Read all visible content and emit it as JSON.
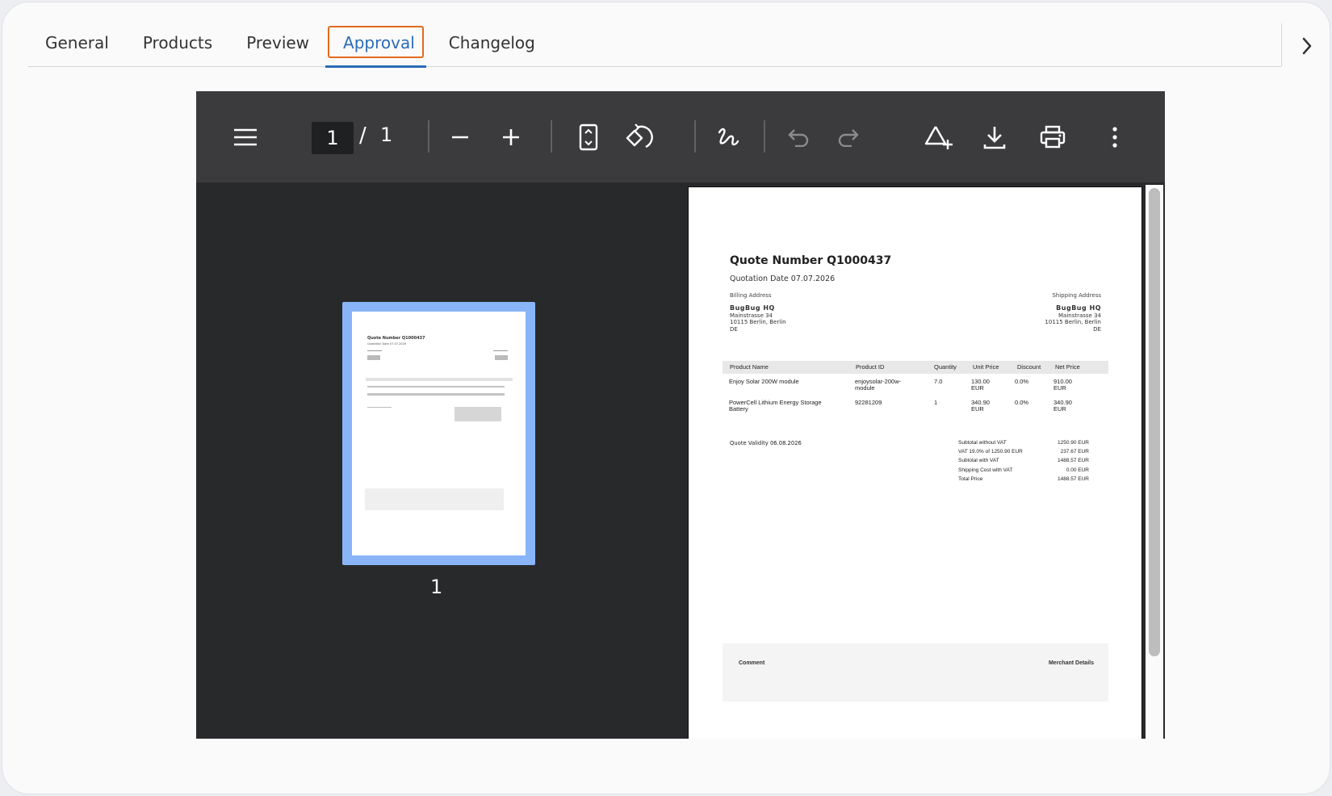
{
  "tabs": [
    {
      "label": "General",
      "active": false
    },
    {
      "label": "Products",
      "active": false
    },
    {
      "label": "Preview",
      "active": false
    },
    {
      "label": "Approval",
      "active": true
    },
    {
      "label": "Changelog",
      "active": false
    }
  ],
  "colors": {
    "accent": "#2b6cb8",
    "focus_outline": "#e26b1d",
    "thumb_highlight": "#8ab4f8"
  },
  "viewer": {
    "current_page": "1",
    "page_separator": "/",
    "total_pages": "1",
    "thumbnail_label": "1",
    "toolbar_icons": [
      "menu-icon",
      "zoom-out-icon",
      "zoom-in-icon",
      "fit-page-icon",
      "rotate-icon",
      "draw-icon",
      "undo-icon",
      "redo-icon",
      "add-annotation-icon",
      "download-icon",
      "print-icon",
      "more-icon"
    ]
  },
  "document": {
    "title": "Quote Number Q1000437",
    "date": "Quotation Date 07.07.2026",
    "billing_heading": "Billing Address",
    "shipping_heading": "Shipping Address",
    "billing": {
      "name": "BugBug HQ",
      "street": "Mainstrasse 34",
      "city": "10115 Berlin, Berlin",
      "country": "DE"
    },
    "shipping": {
      "name": "BugBug HQ",
      "street": "Mainstrasse 34",
      "city": "10115 Berlin, Berlin",
      "country": "DE"
    },
    "table": {
      "headers": [
        "Product Name",
        "Product ID",
        "Quantity",
        "Unit Price",
        "Discount",
        "Net Price"
      ],
      "rows": [
        {
          "name_1": "Enjoy Solar 200W module",
          "name_2": "",
          "id_1": "enjoysolar-200w-",
          "id_2": "module",
          "qty": "7.0",
          "unit_1": "130.00",
          "unit_2": "EUR",
          "discount": "0.0%",
          "net_1": "910.00",
          "net_2": "EUR"
        },
        {
          "name_1": "PowerCell Lithium Energy Storage",
          "name_2": "Battery",
          "id_1": "92281209",
          "id_2": "",
          "qty": "1",
          "unit_1": "340.90",
          "unit_2": "EUR",
          "discount": "0.0%",
          "net_1": "340.90",
          "net_2": "EUR"
        }
      ]
    },
    "validity": "Quote Validity 06.08.2026",
    "totals": [
      {
        "label": "Subtotal without VAT",
        "value": "1250.90 EUR"
      },
      {
        "label": "VAT 19.0% of 1250.90 EUR",
        "value": "237.67 EUR"
      },
      {
        "label": "Subtotal with VAT",
        "value": "1488.57 EUR"
      },
      {
        "label": "Shipping Cost with VAT",
        "value": "0.00 EUR"
      },
      {
        "label": "Total Price",
        "value": "1488.57 EUR"
      }
    ],
    "comment_label": "Comment",
    "merchant_label": "Merchant Details"
  },
  "thumbnail_text": {
    "title": "Quote Number Q1000437",
    "date": "Quotation Date 07.07.2026"
  }
}
